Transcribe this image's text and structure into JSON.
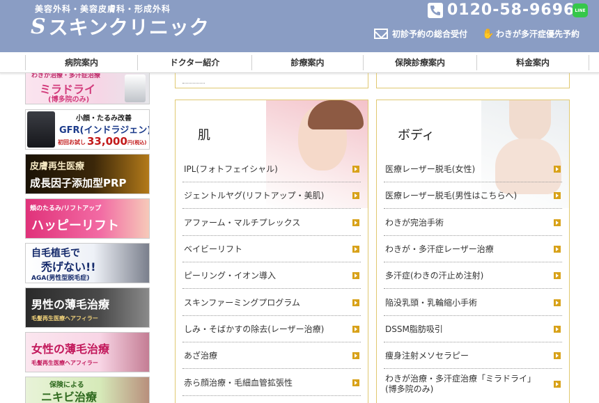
{
  "header": {
    "tagline": "美容外科・美容皮膚科・形成外科",
    "logo_mark": "S",
    "logo_text": "スキンクリニック",
    "phone": "0120-58-9696",
    "line_label": "LINE",
    "reserve_label": "初診予約の総合受付",
    "waki_label": "わきが多汗症優先予約"
  },
  "nav": {
    "items": [
      "病院案内",
      "ドクター紹介",
      "診療案内",
      "保険診療案内",
      "料金案内"
    ]
  },
  "sidebar": {
    "banners": [
      {
        "title": "ミラドライ",
        "sub": "(博多院のみ)",
        "top_text": "わきが治療・多汗症治療"
      },
      {
        "kicker": "小顔・たるみ改善",
        "title": "GFR(インドラジェン)",
        "price_label": "初回お試し",
        "price": "33,000",
        "unit": "円(税込)"
      },
      {
        "title": "皮膚再生医療",
        "sub": "成長因子添加型PRP"
      },
      {
        "kicker": "頬のたるみ/リフトアップ",
        "title": "ハッピーリフト"
      },
      {
        "title": "自毛植毛で",
        "title2": "禿げない!!",
        "sub": "AGA(男性型脱毛症)"
      },
      {
        "title": "男性の薄毛治療",
        "sub": "毛髪再生医療ヘアフィラー"
      },
      {
        "title": "女性の薄毛治療",
        "sub": "毛髪再生医療ヘアフィラー"
      },
      {
        "kicker": "保険による",
        "title": "ニキビ治療"
      }
    ]
  },
  "panels": {
    "skin": {
      "title": "肌",
      "items": [
        "IPL(フォトフェイシャル)",
        "ジェントルヤグ(リフトアップ・美肌)",
        "アファーム・マルチプレックス",
        "ベイビーリフト",
        "ピーリング・イオン導入",
        "スキンファーミングプログラム",
        "しみ・そばかすの除去(レーザー治療)",
        "あざ治療",
        "赤ら顔治療・毛細血管拡張性"
      ]
    },
    "body": {
      "title": "ボディ",
      "items": [
        "医療レーザー脱毛(女性)",
        "医療レーザー脱毛(男性はこちらへ)",
        "わきが完治手術",
        "わきが・多汗症レーザー治療",
        "多汗症(わきの汗止め注射)",
        "陥没乳頭・乳輪縮小手術",
        "DSSM脂肪吸引",
        "痩身注射メソセラピー"
      ],
      "last_item_line1": "わきが治療・多汗症治療「ミラドライ」",
      "last_item_line2": "(博多院のみ)"
    }
  },
  "colors": {
    "header_bg": "#8a9dc4",
    "panel_border": "#e0c870",
    "arrow": "#d8a21a"
  }
}
